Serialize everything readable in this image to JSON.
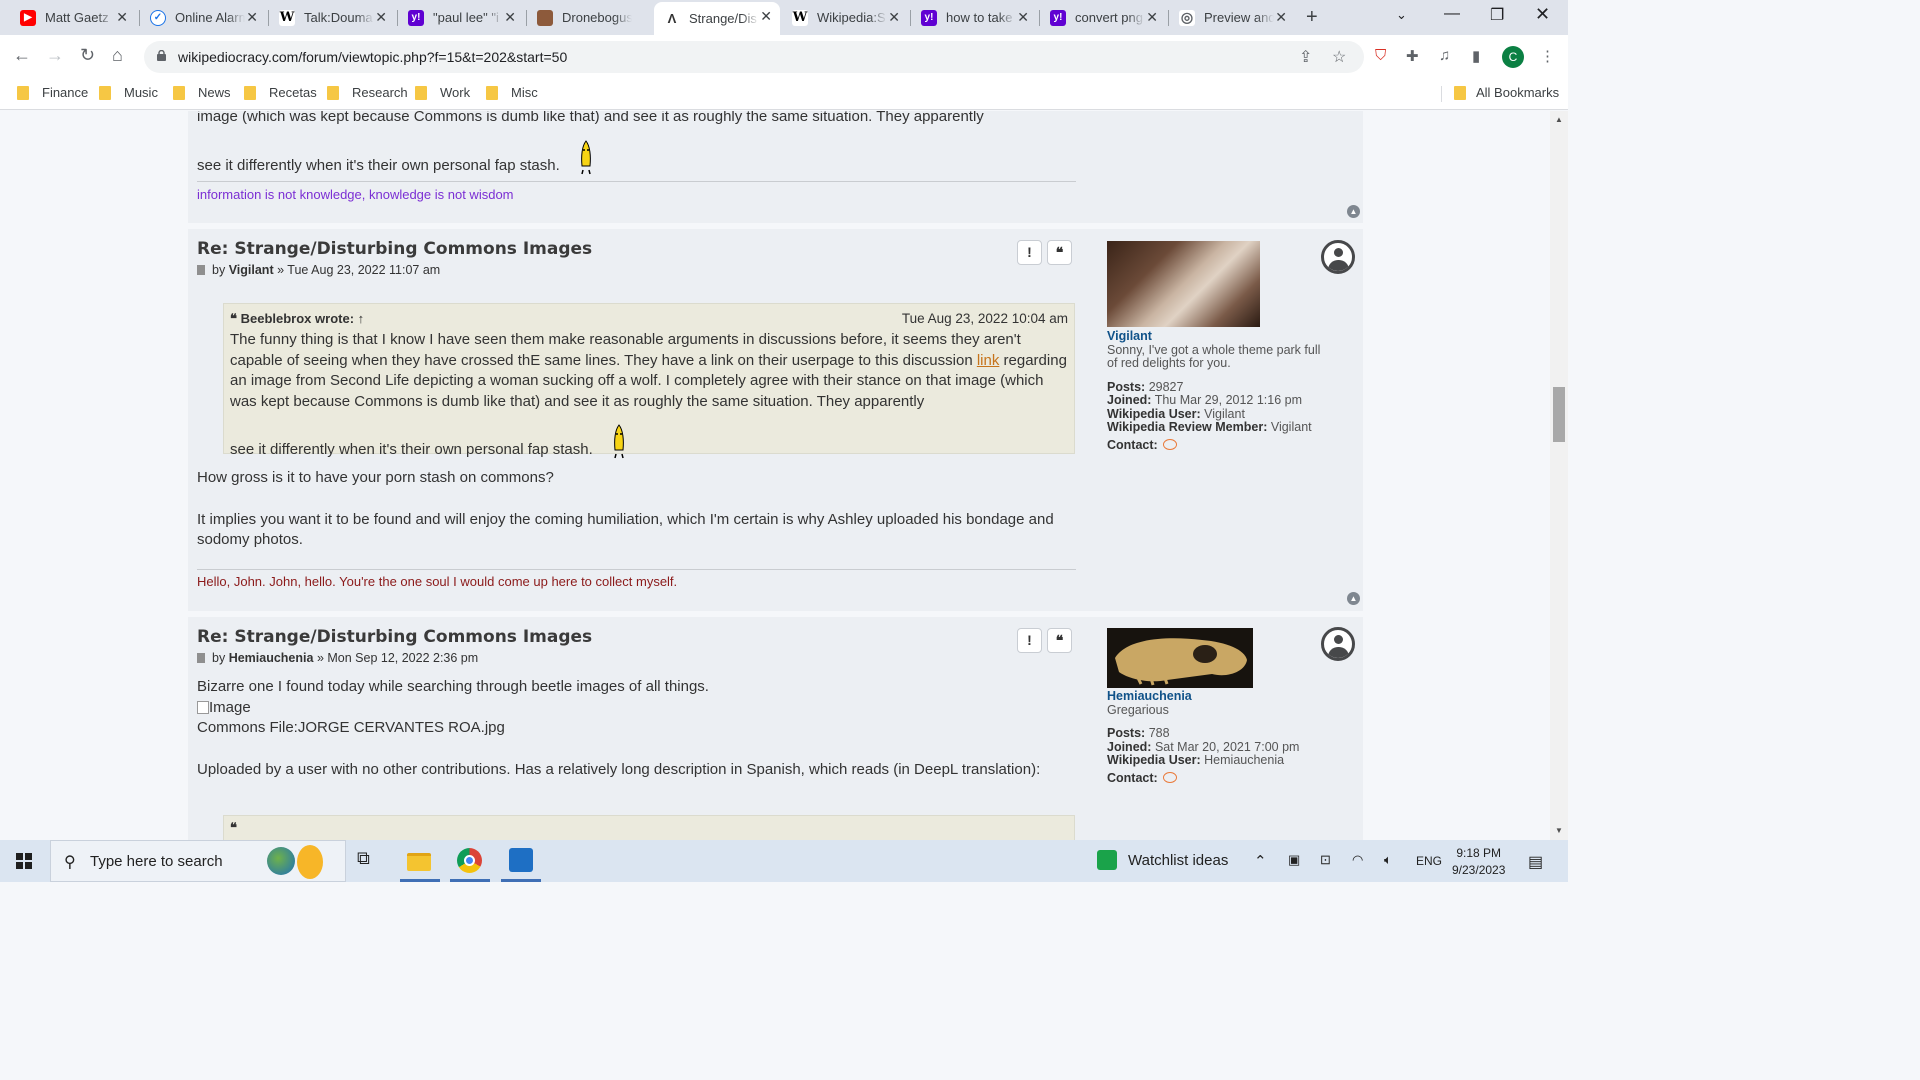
{
  "browser": {
    "tabs": [
      {
        "title": "Matt Gaetz",
        "fav_color": "#ff0000",
        "fav": "▶"
      },
      {
        "title": "Online Alarm",
        "fav_color": "#1a73e8",
        "fav": "✓"
      },
      {
        "title": "Talk:Douma",
        "fav_color": "#ffffff",
        "fav": "W"
      },
      {
        "title": "\"paul lee\" \"i",
        "fav_color": "#6001d2",
        "fav": "y!"
      },
      {
        "title": "Dronebogus",
        "fav_color": "#8d5a3b",
        "fav": ""
      },
      {
        "title": "Strange/Dis",
        "fav_color": "#ffffff",
        "fav": "W"
      },
      {
        "title": "Wikipedia:S",
        "fav_color": "#ffffff",
        "fav": "W"
      },
      {
        "title": "how to take",
        "fav_color": "#6001d2",
        "fav": "y!"
      },
      {
        "title": "convert png",
        "fav_color": "#6001d2",
        "fav": "y!"
      },
      {
        "title": "Preview and",
        "fav_color": "#5f6368",
        "fav": "◎"
      }
    ],
    "url": "wikipediocracy.com/forum/viewtopic.php?f=15&t=202&start=50",
    "avatar_letter": "C",
    "bookmarks": [
      "Finance",
      "Music",
      "News",
      "Recetas",
      "Research",
      "Work",
      "Misc"
    ],
    "all_bookmarks": "All Bookmarks"
  },
  "post0": {
    "text_line1": "image (which was kept because Commons is dumb like that) and see it as roughly the same situation. They apparently",
    "text_line2": "see it differently when it's their own personal fap stash.",
    "signature": "information is not knowledge, knowledge is not wisdom"
  },
  "post1": {
    "title": "Re: Strange/Disturbing Commons Images",
    "by": "by",
    "author": "Vigilant",
    "date": "» Tue Aug 23, 2022 11:07 am",
    "quote_author": "Beeblebrox wrote: ↑",
    "quote_date": "Tue Aug 23, 2022 10:04 am",
    "quote_text_before_link": "The funny thing is that I know I have seen them make reasonable arguments in discussions before, it seems they aren't capable of seeing when they have crossed thE same lines. They have a link on their userpage to this discussion",
    "quote_link": "link",
    "quote_text_after_link": "regarding an image from Second Life depicting a woman sucking off a wolf. I completely agree with their stance on that image (which was kept because Commons is dumb like that) and see it as roughly the same situation. They apparently",
    "quote_last_line": "see it differently when it's their own personal fap stash.",
    "para1": "How gross is it to have your porn stash on commons?",
    "para2": "It implies you want it to be found and will enjoy the coming humiliation, which I'm certain is why Ashley uploaded his bondage and sodomy photos.",
    "signature": "Hello, John. John, hello. You're the one soul I would come up here to collect myself.",
    "profile": {
      "username": "Vigilant",
      "rank": "Sonny, I've got a whole theme park full of red delights for you.",
      "posts_label": "Posts:",
      "posts": "29827",
      "joined_label": "Joined:",
      "joined": "Thu Mar 29, 2012 1:16 pm",
      "wp_user_label": "Wikipedia User:",
      "wp_user": "Vigilant",
      "wr_member_label": "Wikipedia Review Member:",
      "wr_member": "Vigilant",
      "contact_label": "Contact:"
    }
  },
  "post2": {
    "title": "Re: Strange/Disturbing Commons Images",
    "by": "by",
    "author": "Hemiauchenia",
    "date": "» Mon Sep 12, 2022 2:36 pm",
    "line1": "Bizarre one I found today while searching through beetle images of all things.",
    "image_alt": "Image",
    "line3": "Commons File:JORGE CERVANTES ROA.jpg",
    "para2": "Uploaded by a user with no other contributions. Has a relatively long description in Spanish, which reads (in DeepL translation):",
    "profile": {
      "username": "Hemiauchenia",
      "rank": "Gregarious",
      "posts_label": "Posts:",
      "posts": "788",
      "joined_label": "Joined:",
      "joined": "Sat Mar 20, 2021 7:00 pm",
      "wp_user_label": "Wikipedia User:",
      "wp_user": "Hemiauchenia",
      "contact_label": "Contact:"
    }
  },
  "taskbar": {
    "search_placeholder": "Type here to search",
    "watchlist": "Watchlist ideas",
    "lang": "ENG",
    "time": "9:18 PM",
    "date": "9/23/2023"
  }
}
